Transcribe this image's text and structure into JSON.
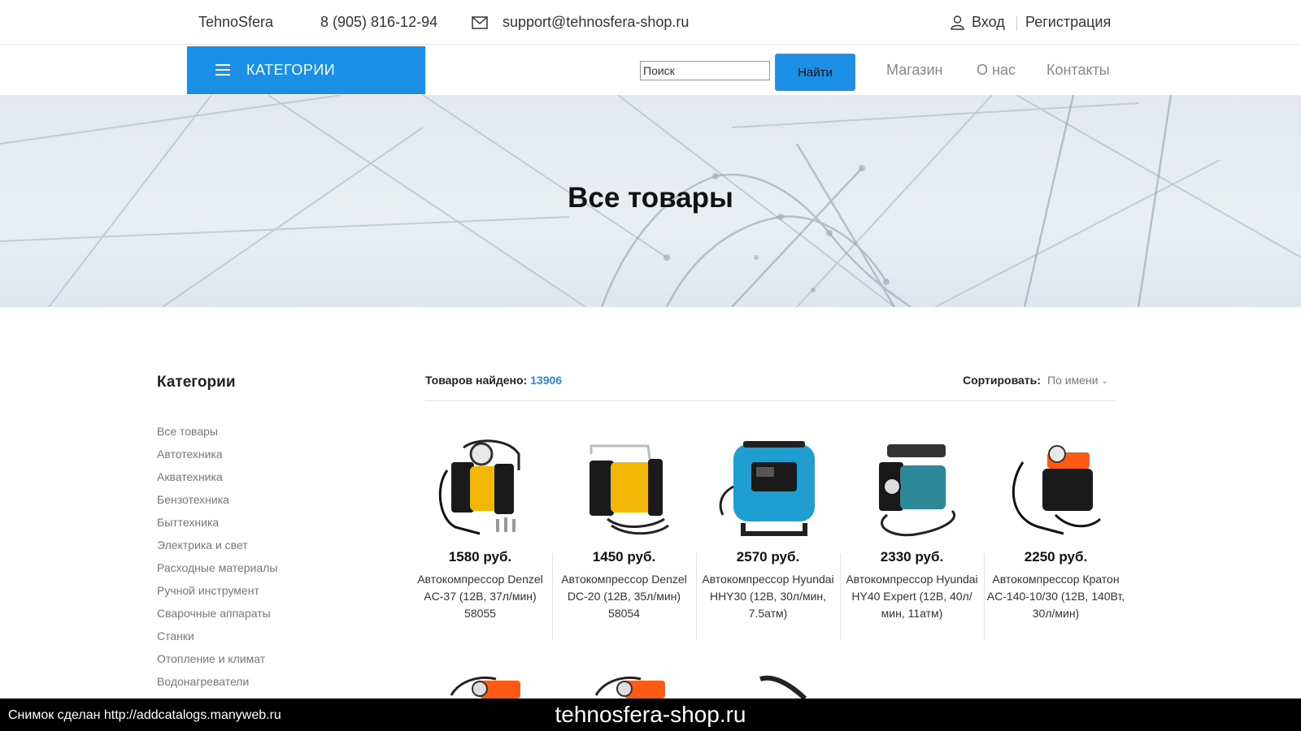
{
  "topbar": {
    "brand": "TehnoSfera",
    "phone": "8 (905) 816-12-94",
    "email": "support@tehnosfera-shop.ru",
    "login": "Вход",
    "register": "Регистрация"
  },
  "nav": {
    "categories_button": "КАТЕГОРИИ",
    "search_placeholder": "Поиск",
    "search_button": "Найти",
    "links": [
      "Магазин",
      "О нас",
      "Контакты"
    ]
  },
  "hero": {
    "title": "Все товары"
  },
  "sidebar": {
    "title": "Категории",
    "items": [
      "Все товары",
      "Автотехника",
      "Акватехника",
      "Бензотехника",
      "Быттехника",
      "Электрика и свет",
      "Расходные материалы",
      "Ручной инструмент",
      "Сварочные аппараты",
      "Станки",
      "Отопление и климат",
      "Водонагреватели"
    ]
  },
  "results": {
    "found_label": "Товаров найдено:",
    "found_count": "13906",
    "sort_label": "Сортировать:",
    "sort_value": "По имени"
  },
  "products": [
    {
      "price": "1580 руб.",
      "name": "Автокомпрессор Denzel AC-37 (12В, 37л/мин) 58055",
      "image": "compressor-yellow-icon"
    },
    {
      "price": "1450 руб.",
      "name": "Автокомпрессор Denzel DC-20 (12В, 35л/мин) 58054",
      "image": "compressor-yellow-icon"
    },
    {
      "price": "2570 руб.",
      "name": "Автокомпрессор Hyundai HHY30 (12В, 30л/мин, 7.5атм)",
      "image": "compressor-blue-icon"
    },
    {
      "price": "2330 руб.",
      "name": "Автокомпрессор Hyundai HY40 Expert (12В, 40л/мин, 11атм)",
      "image": "compressor-teal-icon"
    },
    {
      "price": "2250 руб.",
      "name": "Автокомпрессор Кратон AC-140-10/30 (12В, 140Вт, 30л/мин)",
      "image": "compressor-orange-icon"
    }
  ],
  "colors": {
    "accent": "#1b8fe6",
    "count": "#2a8ad0",
    "muted_text": "#777777"
  },
  "caption": {
    "left": "Снимок сделан http://addcatalogs.manyweb.ru",
    "center": "tehnosfera-shop.ru"
  }
}
